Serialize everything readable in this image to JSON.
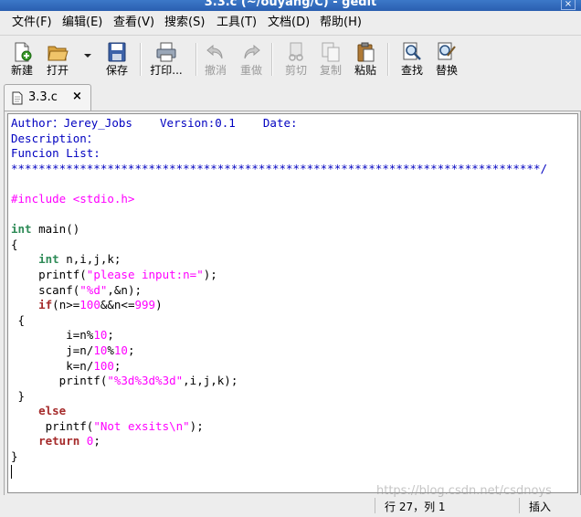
{
  "window": {
    "title": "3.3.c (~/ouyang/C) - gedit",
    "close_label": "×"
  },
  "menubar": {
    "items": [
      "文件(F)",
      "编辑(E)",
      "查看(V)",
      "搜索(S)",
      "工具(T)",
      "文档(D)",
      "帮助(H)"
    ]
  },
  "toolbar": {
    "new": "新建",
    "open": "打开",
    "save": "保存",
    "print": "打印...",
    "undo": "撤消",
    "redo": "重做",
    "cut": "剪切",
    "copy": "复制",
    "paste": "粘贴",
    "find": "查找",
    "replace": "替换"
  },
  "tabs": [
    {
      "label": "3.3.c",
      "close": "×"
    }
  ],
  "editor": {
    "lines": [
      [
        [
          "Author：Jerey_Jobs    Version:0.1    Date:",
          "blue"
        ]
      ],
      [
        [
          "Description：",
          "blue"
        ]
      ],
      [
        [
          "Funcion List:",
          "blue"
        ]
      ],
      [
        [
          "*****************************************************************************/",
          "blue"
        ]
      ],
      [
        [
          "",
          "default"
        ]
      ],
      [
        [
          "#include <stdio.h>",
          "pink"
        ]
      ],
      [
        [
          "",
          "default"
        ]
      ],
      [
        [
          "int",
          "green"
        ],
        [
          " main()",
          "default"
        ]
      ],
      [
        [
          "{",
          "default"
        ]
      ],
      [
        [
          "    ",
          "default"
        ],
        [
          "int",
          "green"
        ],
        [
          " n,i,j,k;",
          "default"
        ]
      ],
      [
        [
          "    printf(",
          "default"
        ],
        [
          "\"please input:n=\"",
          "pink"
        ],
        [
          ");",
          "default"
        ]
      ],
      [
        [
          "    scanf(",
          "default"
        ],
        [
          "\"%d\"",
          "pink"
        ],
        [
          ",&n);",
          "default"
        ]
      ],
      [
        [
          "    ",
          "default"
        ],
        [
          "if",
          "keyword"
        ],
        [
          "(n>=",
          "default"
        ],
        [
          "100",
          "pink"
        ],
        [
          "&&n<=",
          "default"
        ],
        [
          "999",
          "pink"
        ],
        [
          ")",
          "default"
        ]
      ],
      [
        [
          " {",
          "default"
        ]
      ],
      [
        [
          "        i=n%",
          "default"
        ],
        [
          "10",
          "pink"
        ],
        [
          ";",
          "default"
        ]
      ],
      [
        [
          "        j=n/",
          "default"
        ],
        [
          "10",
          "pink"
        ],
        [
          "%",
          "default"
        ],
        [
          "10",
          "pink"
        ],
        [
          ";",
          "default"
        ]
      ],
      [
        [
          "        k=n/",
          "default"
        ],
        [
          "100",
          "pink"
        ],
        [
          ";",
          "default"
        ]
      ],
      [
        [
          "       printf(",
          "default"
        ],
        [
          "\"%3d%3d%3d\"",
          "pink"
        ],
        [
          ",i,j,k);",
          "default"
        ]
      ],
      [
        [
          " }",
          "default"
        ]
      ],
      [
        [
          "    ",
          "default"
        ],
        [
          "else",
          "keyword"
        ]
      ],
      [
        [
          "     printf(",
          "default"
        ],
        [
          "\"Not exsits\\n\"",
          "pink"
        ],
        [
          ");",
          "default"
        ]
      ],
      [
        [
          "    ",
          "default"
        ],
        [
          "return",
          "keyword"
        ],
        [
          " ",
          "default"
        ],
        [
          "0",
          "pink"
        ],
        [
          ";",
          "default"
        ]
      ],
      [
        [
          "}",
          "default"
        ]
      ],
      [
        [
          "",
          "cursor"
        ]
      ]
    ]
  },
  "statusbar": {
    "position": "行 27，列 1",
    "mode": "插入",
    "watermark": "https://blog.csdn.net/csdnoys"
  }
}
